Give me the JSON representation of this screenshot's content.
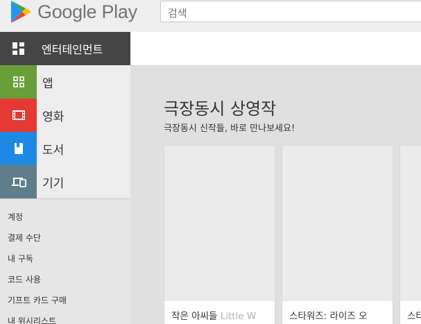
{
  "header": {
    "logo_text": "Google Play",
    "search_placeholder": "검색"
  },
  "sidebar": {
    "active": {
      "label": "엔터테인먼트",
      "icon": "entertainment-grid-icon",
      "color": "#454545"
    },
    "categories": [
      {
        "label": "앱",
        "icon": "apps-icon",
        "color": "#689f38"
      },
      {
        "label": "영화",
        "icon": "film-icon",
        "color": "#e53935"
      },
      {
        "label": "도서",
        "icon": "book-icon",
        "color": "#1e88e5"
      },
      {
        "label": "기기",
        "icon": "devices-icon",
        "color": "#607d8b"
      }
    ],
    "links": [
      "계정",
      "결제 수단",
      "내 구독",
      "코드 사용",
      "기프트 카드 구매",
      "내 위시리스트"
    ]
  },
  "main": {
    "cluster_title": "극장동시 상영작",
    "cluster_subtitle": "극장동시 신작들, 바로 만나보세요!",
    "cards": [
      {
        "title_ko": "작은 아씨들 ",
        "title_en": "Little W"
      },
      {
        "title_ko": "스타워즈: 라이즈 오",
        "title_en": ""
      },
      {
        "title_ko": "스타",
        "title_en": ""
      }
    ]
  }
}
